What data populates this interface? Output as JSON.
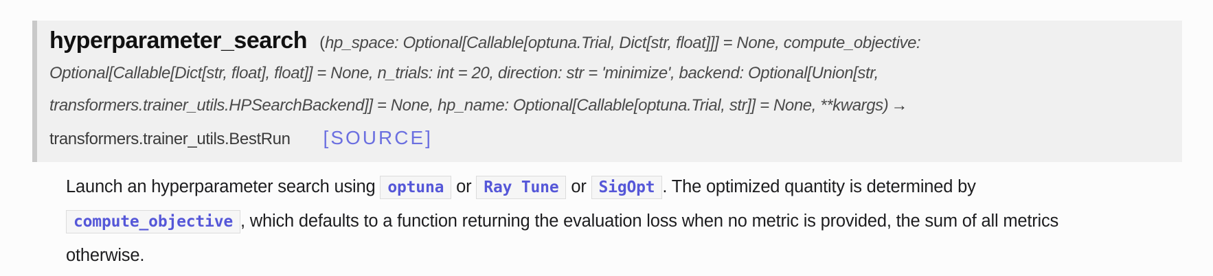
{
  "signature": {
    "name": "hyperparameter_search",
    "open_paren": "(",
    "params_line1": "hp_space: Optional[Callable[optuna.Trial, Dict[str, float]]] = None, compute_objective:",
    "params_line2": "Optional[Callable[Dict[str, float], float]] = None, n_trials: int = 20, direction: str = 'minimize', backend: Optional[Union[str,",
    "params_line3": "transformers.trainer_utils.HPSearchBackend]] = None, hp_name: Optional[Callable[optuna.Trial, str]] = None, **kwargs",
    "close_paren": ")",
    "arrow": "→",
    "return_type": "transformers.trainer_utils.BestRun",
    "source_label": "[SOURCE]"
  },
  "description": {
    "text1": "Launch an hyperparameter search using ",
    "code_optuna": "optuna",
    "or1": " or ",
    "code_raytune": "Ray Tune",
    "or2": " or ",
    "code_sigopt": "SigOpt",
    "text2": ". The optimized quantity is determined by",
    "code_compute_objective": "compute_objective",
    "text3": ", which defaults to a function returning the evaluation loss when no metric is provided, the sum of all metrics",
    "text4": "otherwise."
  }
}
